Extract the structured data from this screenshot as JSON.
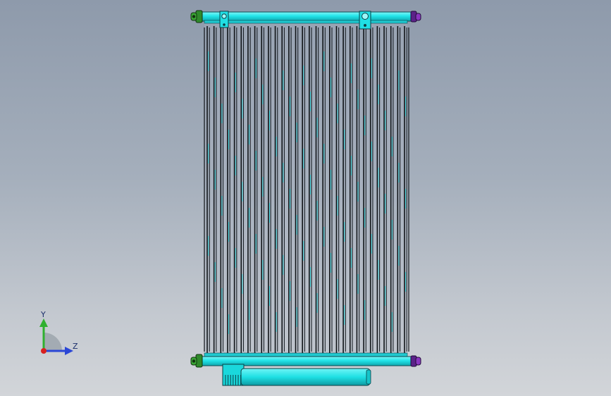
{
  "viewport": {
    "background_top": "#8e9aab",
    "background_bottom": "#d2d5d9"
  },
  "model": {
    "part": "condenser",
    "tube_count": 30,
    "colors": {
      "header_pipe": "#21e4e8",
      "header_outline": "#0a4a52",
      "tube_edge": "#101418",
      "tube_highlight": "#2ee0e6",
      "fitting_green": "#2f8a2b",
      "fitting_purple": "#7a2aa8",
      "receiver_drier": "#1fe0e4"
    }
  },
  "triad": {
    "y_label": "Y",
    "z_label": "Z",
    "y_color": "#2fb02f",
    "z_color": "#2b47d6",
    "x_color": "#d82020"
  }
}
